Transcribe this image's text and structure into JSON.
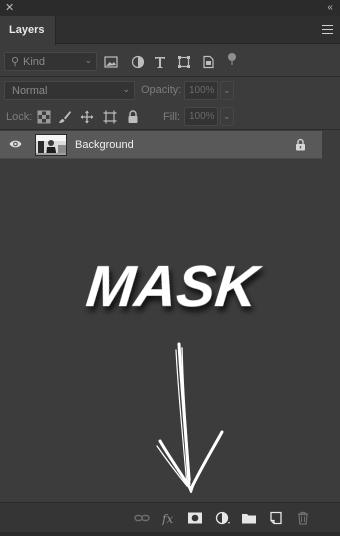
{
  "window": {
    "close_glyph": "✕",
    "collapse_glyph": "‹‹"
  },
  "panel": {
    "tab_label": "Layers",
    "menu_icon": "panel-menu-icon"
  },
  "filter": {
    "kind_label": "Kind",
    "filter_icons": [
      "image-filter-icon",
      "adjustment-filter-icon",
      "type-filter-icon",
      "shape-filter-icon",
      "smart-object-filter-icon",
      "filter-toggle-icon"
    ]
  },
  "blend": {
    "mode_value": "Normal",
    "opacity_label": "Opacity:",
    "opacity_value": "100%",
    "lock_label": "Lock:",
    "fill_label": "Fill:",
    "fill_value": "100%"
  },
  "lock_icons": [
    "lock-transparent-pixels-icon",
    "lock-image-pixels-icon",
    "lock-position-icon",
    "lock-artboard-icon",
    "lock-all-icon"
  ],
  "layers": [
    {
      "name": "Background",
      "visible": true,
      "locked": true
    }
  ],
  "overlay": {
    "text": "MASK"
  },
  "footer_icons": [
    "link-layers-icon",
    "fx-icon",
    "add-mask-icon",
    "adjustment-layer-icon",
    "group-folder-icon",
    "new-layer-icon",
    "trash-icon"
  ],
  "colors": {
    "panel_bg": "#3c3c3c",
    "selected_layer": "#595959",
    "text": "#cfcfcf"
  }
}
